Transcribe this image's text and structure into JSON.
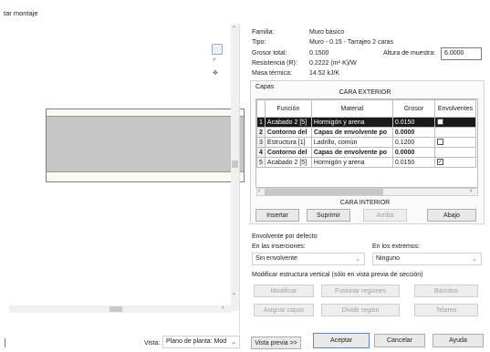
{
  "window": {
    "title": "tar montaje"
  },
  "preview": {
    "view_label": "Vista:",
    "view_select": "Plano de planta: Mod",
    "preview_button": "Vista previa >>"
  },
  "properties": {
    "family_label": "Familia:",
    "family_value": "Muro básico",
    "type_label": "Tipo:",
    "type_value": "Muro - 0.15 - Tarrajeo 2 caras",
    "thickness_label": "Grosor total:",
    "thickness_value": "0.1500",
    "sample_height_label": "Altura de muestra:",
    "sample_height_value": "6.0000",
    "resistance_label": "Resistencia (R):",
    "resistance_value": "0.2222 (m²·K)/W",
    "thermal_mass_label": "Masa térmica:",
    "thermal_mass_value": "14.52 kJ/K"
  },
  "layers": {
    "group_label": "Capas",
    "exterior_label": "CARA EXTERIOR",
    "interior_label": "CARA INTERIOR",
    "columns": [
      "Función",
      "Material",
      "Grosor",
      "Envolventes"
    ],
    "rows": [
      {
        "num": "1",
        "funcion": "Acabado 2 [5]",
        "material": "Hormigón y arena",
        "grosor": "0.0150",
        "wraps": true,
        "style": "selected"
      },
      {
        "num": "2",
        "funcion": "Contorno del",
        "material": "Capas de envolvente po",
        "grosor": "0.0000",
        "wraps": null,
        "style": "bold"
      },
      {
        "num": "3",
        "funcion": "Estructura [1]",
        "material": "Ladrillo, común",
        "grosor": "0.1200",
        "wraps": false,
        "style": "normal"
      },
      {
        "num": "4",
        "funcion": "Contorno del",
        "material": "Capas de envolvente po",
        "grosor": "0.0000",
        "wraps": null,
        "style": "bold"
      },
      {
        "num": "5",
        "funcion": "Acabado 2 [5]",
        "material": "Hormigón y arena",
        "grosor": "0.0150",
        "wraps": true,
        "style": "normal"
      }
    ],
    "buttons": {
      "insert": "Insertar",
      "delete": "Suprimir",
      "up": "Arriba",
      "down": "Abajo"
    }
  },
  "wrapping": {
    "title": "Envolvente por defecto",
    "inserts_label": "En las inserciones:",
    "inserts_value": "Sin envolvente",
    "ends_label": "En los extremos:",
    "ends_value": "Ninguno"
  },
  "vertical": {
    "title": "Modificar estructura vertical (sólo en vista previa de sección)",
    "modify": "Modificar",
    "merge": "Fusionar regiones",
    "sweeps": "Barridos",
    "assign": "Asignar capas",
    "split": "Dividir región",
    "reveals": "Telares"
  },
  "footer": {
    "ok": "Aceptar",
    "cancel": "Cancelar",
    "help": "Ayuda"
  }
}
